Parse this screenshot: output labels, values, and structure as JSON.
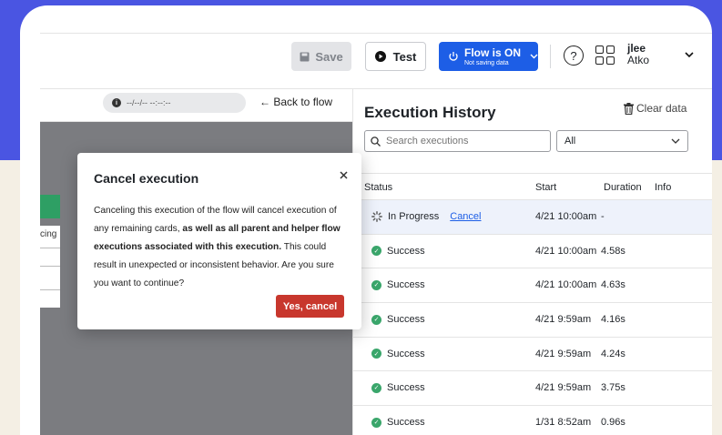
{
  "toolbar": {
    "save_label": "Save",
    "test_label": "Test",
    "flow_label": "Flow is ON",
    "flow_sub": "Not saving data",
    "help_glyph": "?"
  },
  "user": {
    "name": "jlee",
    "org": "Atko"
  },
  "left": {
    "date_text": "--/--/-- --:--:--",
    "back_label": "← Back to flow",
    "cut_label": "cing"
  },
  "modal": {
    "title": "Cancel execution",
    "body_1": "Canceling this execution of the flow will cancel execution of any remaining cards, ",
    "body_bold": "as well as all parent and helper flow executions associated with this execution.",
    "body_2": " This could result in unexpected or inconsistent behavior. Are you sure you want to continue?",
    "confirm_label": "Yes, cancel"
  },
  "history": {
    "title": "Execution History",
    "clear_label": "Clear data",
    "search_placeholder": "Search executions",
    "filter_value": "All",
    "columns": {
      "status": "Status",
      "start": "Start",
      "duration": "Duration",
      "info": "Info"
    },
    "rows": [
      {
        "status": "In Progress",
        "action": "Cancel",
        "start": "4/21 10:00am",
        "duration": "-"
      },
      {
        "status": "Success",
        "start": "4/21 10:00am",
        "duration": "4.58s"
      },
      {
        "status": "Success",
        "start": "4/21 10:00am",
        "duration": "4.63s"
      },
      {
        "status": "Success",
        "start": "4/21 9:59am",
        "duration": "4.16s"
      },
      {
        "status": "Success",
        "start": "4/21 9:59am",
        "duration": "4.24s"
      },
      {
        "status": "Success",
        "start": "4/21 9:59am",
        "duration": "3.75s"
      },
      {
        "status": "Success",
        "start": "1/31 8:52am",
        "duration": "0.96s"
      }
    ]
  },
  "colors": {
    "brand_blue": "#1d5ee6",
    "danger": "#c8372d",
    "success": "#3aa66b",
    "background": "#4a55e2"
  }
}
